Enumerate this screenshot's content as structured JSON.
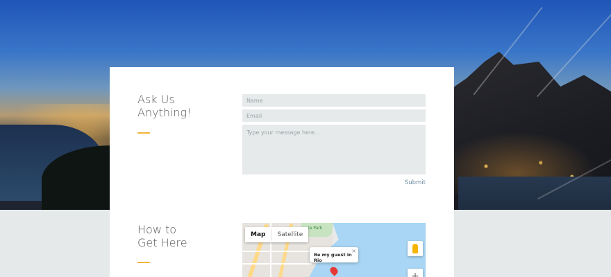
{
  "contact": {
    "heading_line1": "Ask Us",
    "heading_line2": "Anything!",
    "name_placeholder": "Name",
    "email_placeholder": "Email",
    "message_placeholder": "Type your message here...",
    "submit_label": "Submit"
  },
  "directions": {
    "heading_line1": "How to",
    "heading_line2": "Get Here",
    "map": {
      "type_map": "Map",
      "type_satellite": "Satellite",
      "infowindow_text": "Be my guest in Rio",
      "close_glyph": "×",
      "zoom_in_glyph": "+",
      "park_label": "le Park"
    }
  },
  "colors": {
    "accent": "#f0b43a",
    "submit_text": "#6a8aa0",
    "field_bg": "#e6eaeb",
    "page_bg": "#e5e9ea"
  }
}
